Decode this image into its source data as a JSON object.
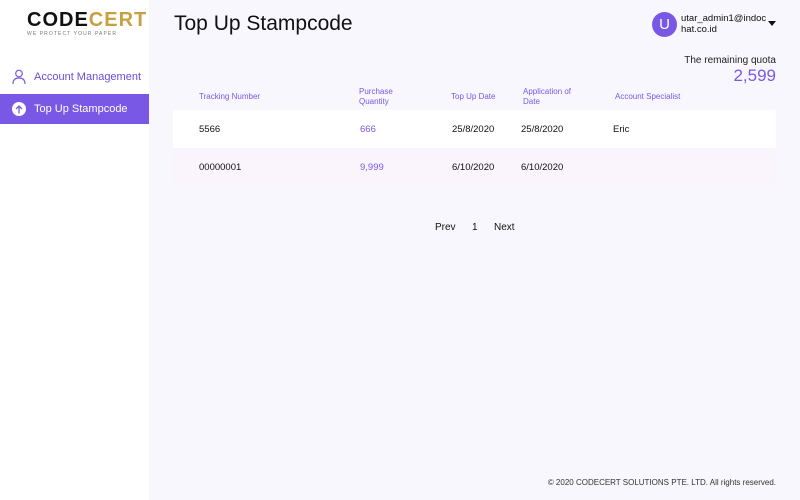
{
  "sidebar": {
    "logo": {
      "main_a": "CODE",
      "main_b": "CERT",
      "tagline": "WE PROTECT YOUR PAPER"
    },
    "items": [
      {
        "label": "Account Management",
        "icon": "user-icon",
        "active": false
      },
      {
        "label": "Top Up Stampcode",
        "icon": "arrow-up-circle-icon",
        "active": true
      }
    ]
  },
  "header": {
    "title": "Top Up Stampcode",
    "user": {
      "avatar_letter": "U",
      "email": "utar_admin1@indochat.co.id"
    }
  },
  "quota": {
    "label": "The remaining quota",
    "value": "2,599"
  },
  "table": {
    "columns": [
      "Tracking Number",
      "Purchase Quantity",
      "Top Up Date",
      "Application of Date",
      "Account Specialist"
    ],
    "rows": [
      {
        "tracking": "5566",
        "quantity": "666",
        "topup_date": "25/8/2020",
        "application_date": "25/8/2020",
        "specialist": "Eric"
      },
      {
        "tracking": "00000001",
        "quantity": "9,999",
        "topup_date": "6/10/2020",
        "application_date": "6/10/2020",
        "specialist": ""
      }
    ]
  },
  "pagination": {
    "prev": "Prev",
    "page": "1",
    "next": "Next"
  },
  "footer": {
    "copyright": "© 2020 CODECERT SOLUTIONS PTE. LTD. All rights reserved."
  },
  "colors": {
    "accent": "#7a58e6",
    "background": "#f7f7fd",
    "logo_gold": "#c8a040"
  }
}
